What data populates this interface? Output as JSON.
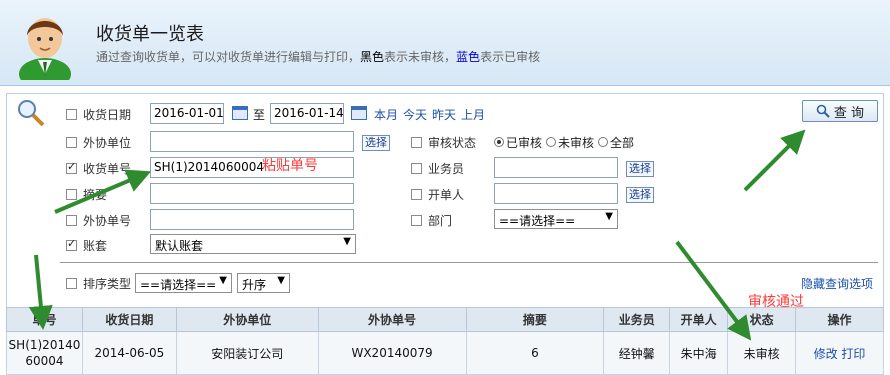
{
  "header": {
    "title": "收货单一览表",
    "desc_prefix": "通过查询收货单，可以对收货单进行编辑与打印，",
    "desc_black": "黑色",
    "desc_mid": "表示未审核，",
    "desc_blue": "蓝色",
    "desc_suffix": "表示已审核"
  },
  "filters": {
    "date_label": "收货日期",
    "date_from": "2016-01-01",
    "date_to_sep": "至",
    "date_to": "2016-01-14",
    "quick_month": "本月",
    "quick_today": "今天",
    "quick_yesterday": "昨天",
    "quick_lastmonth": "上月",
    "vendor_label": "外协单位",
    "pick_label": "选择",
    "receipt_no_label": "收货单号",
    "receipt_no_value": "SH(1)2014060004",
    "summary_label": "摘要",
    "ext_no_label": "外协单号",
    "account_label": "账套",
    "account_value": "默认账套",
    "audit_label": "审核状态",
    "audit_options": [
      "已审核",
      "未审核",
      "全部"
    ],
    "salesman_label": "业务员",
    "creator_label": "开单人",
    "dept_label": "部门",
    "dept_value": "==请选择==",
    "sort_label": "排序类型",
    "sort_value": "==请选择==",
    "sort_order": "升序",
    "hide_options": "隐藏查询选项",
    "query_button": "查 询"
  },
  "annotations": {
    "paste_hint": "粘贴单号",
    "audit_passed": "审核通过"
  },
  "table": {
    "headers": [
      "单号",
      "收货日期",
      "外协单位",
      "外协单号",
      "摘要",
      "业务员",
      "开单人",
      "状态",
      "操作"
    ],
    "rows": [
      {
        "no": "SH(1)2014060004",
        "date": "2014-06-05",
        "vendor": "安阳装订公司",
        "ext_no": "WX20140079",
        "summary": "6",
        "salesman": "经钟馨",
        "creator": "朱中海",
        "status": "未审核",
        "op_edit": "修改",
        "op_print": "打印"
      }
    ]
  },
  "colors": {
    "accent": "#1a4fa8",
    "annotation": "#ff3a3a",
    "arrow": "#2e8b2e"
  }
}
